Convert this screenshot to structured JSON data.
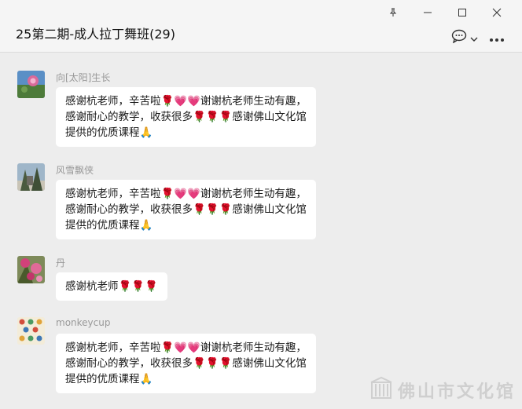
{
  "window": {
    "title": "25第二期-成人拉丁舞班(29)",
    "controls": [
      "pin-icon",
      "minimize-icon",
      "maximize-icon",
      "close-icon"
    ]
  },
  "header_actions": [
    "chat-bubble-icon",
    "chevron-down-icon",
    "more-icon"
  ],
  "messages": [
    {
      "sender": "向[太阳]生长",
      "lines": [
        "感谢杭老师，辛苦啦🌹💗💗谢谢杭老师生动有趣，",
        "感谢耐心的教学，收获很多🌹🌹🌹感谢佛山文化馆",
        "提供的优质课程🙏"
      ]
    },
    {
      "sender": "风雪飘侠",
      "lines": [
        "感谢杭老师，辛苦啦🌹💗💗谢谢杭老师生动有趣，",
        "感谢耐心的教学，收获很多🌹🌹🌹感谢佛山文化馆",
        "提供的优质课程🙏"
      ]
    },
    {
      "sender": "丹",
      "lines": [
        "感谢杭老师🌹🌹🌹"
      ]
    },
    {
      "sender": "monkeycup",
      "lines": [
        "感谢杭老师，辛苦啦🌹💗💗谢谢杭老师生动有趣，",
        "感谢耐心的教学，收获很多🌹🌹🌹感谢佛山文化馆",
        "提供的优质课程🙏"
      ]
    }
  ],
  "watermark": "佛山市文化馆",
  "colors": {
    "background": "#ededed",
    "header": "#f5f5f5",
    "bubble": "#ffffff",
    "sender_text": "#999999"
  }
}
